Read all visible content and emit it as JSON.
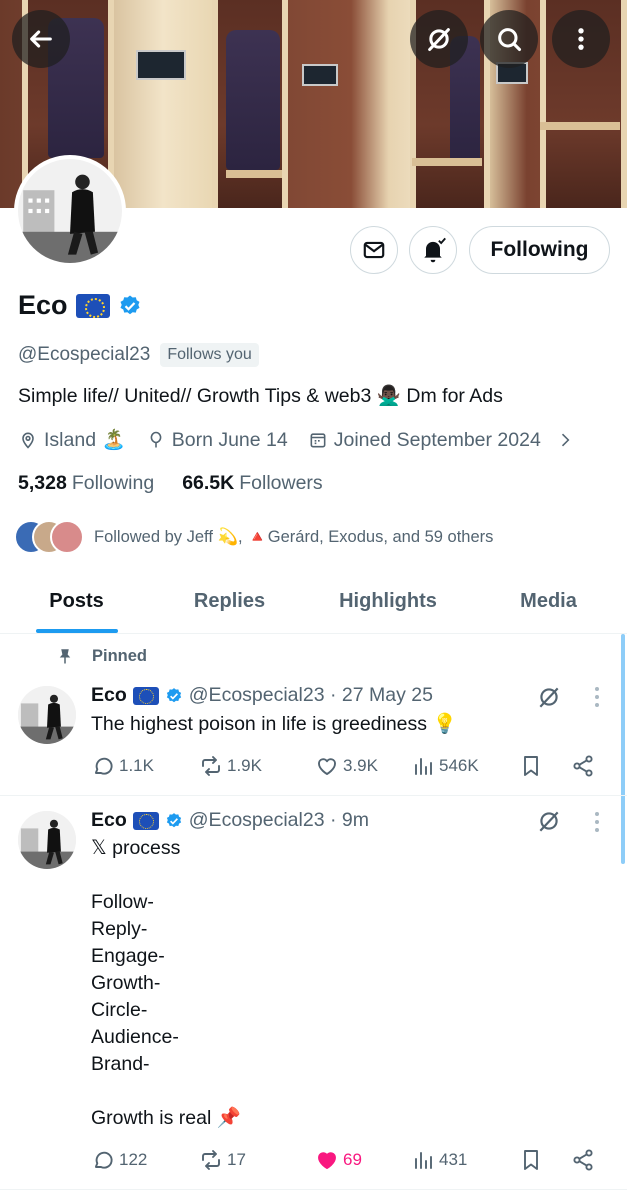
{
  "profile": {
    "name": "Eco",
    "handle": "@Ecospecial23",
    "follows_you": "Follows you",
    "bio": "Simple life// United// Growth Tips & web3 🙅🏿‍♂️ Dm for Ads",
    "location": "Island 🏝️",
    "born": "Born June 14",
    "joined": "Joined September 2024",
    "following_count": "5,328",
    "following_label": "Following",
    "followers_count": "66.5K",
    "followers_label": "Followers",
    "followed_by": "Followed by Jeff 💫, 🔺Gerárd, Exodus, and 59 others",
    "following_button": "Following"
  },
  "icons": {
    "back": "arrow-left-icon",
    "grok": "grok-icon",
    "search": "search-icon",
    "more": "more-vertical-icon",
    "message": "envelope-icon",
    "notify": "bell-check-icon"
  },
  "tabs": [
    {
      "label": "Posts",
      "active": true
    },
    {
      "label": "Replies",
      "active": false
    },
    {
      "label": "Highlights",
      "active": false
    },
    {
      "label": "Media",
      "active": false
    }
  ],
  "posts": [
    {
      "pinned_label": "Pinned",
      "name": "Eco",
      "handle_time": "@Ecospecial23 · 27 May 25",
      "text": "The highest poison in life is greediness 💡",
      "replies": "1.1K",
      "reposts": "1.9K",
      "likes": "3.9K",
      "views": "546K"
    },
    {
      "name": "Eco",
      "handle_time": "@Ecospecial23 · 9m",
      "text": "𝕏 process\n\nFollow-\nReply-\nEngage-\nGrowth-\nCircle-\nAudience-\nBrand-\n\nGrowth is real 📌",
      "replies": "122",
      "reposts": "17",
      "likes": "69",
      "views": "431"
    }
  ],
  "colors": {
    "accent": "#1d9bf0",
    "like": "#f91880",
    "text_secondary": "#536471",
    "verified": "#1d9bf0",
    "flag": "#1d4fb8"
  }
}
